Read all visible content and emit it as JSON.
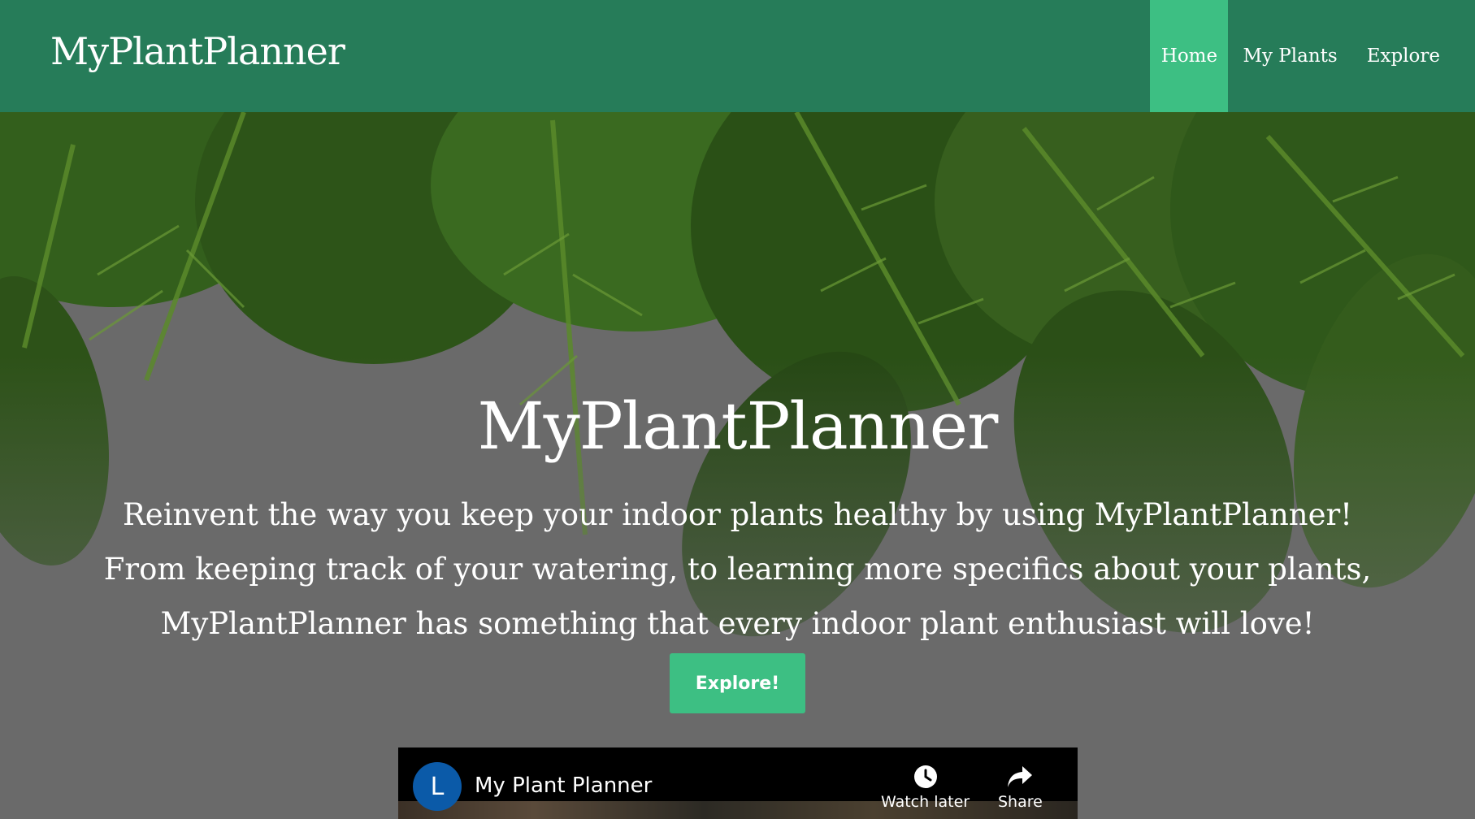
{
  "navbar": {
    "brand": "MyPlantPlanner",
    "items": [
      {
        "label": "Home",
        "active": true
      },
      {
        "label": "My Plants",
        "active": false
      },
      {
        "label": "Explore",
        "active": false
      }
    ],
    "bg_color": "#267c59",
    "active_color": "#3dbf83"
  },
  "hero": {
    "title": "MyPlantPlanner",
    "lines": [
      "Reinvent the way you keep your indoor plants healthy by using MyPlantPlanner!",
      "From keeping track of your watering, to learning more specifics about your plants,",
      "MyPlantPlanner has something that every indoor plant enthusiast will love!"
    ],
    "button_label": "Explore!"
  },
  "video": {
    "channel_initial": "L",
    "title": "My Plant Planner",
    "watch_later_label": "Watch later",
    "share_label": "Share"
  }
}
